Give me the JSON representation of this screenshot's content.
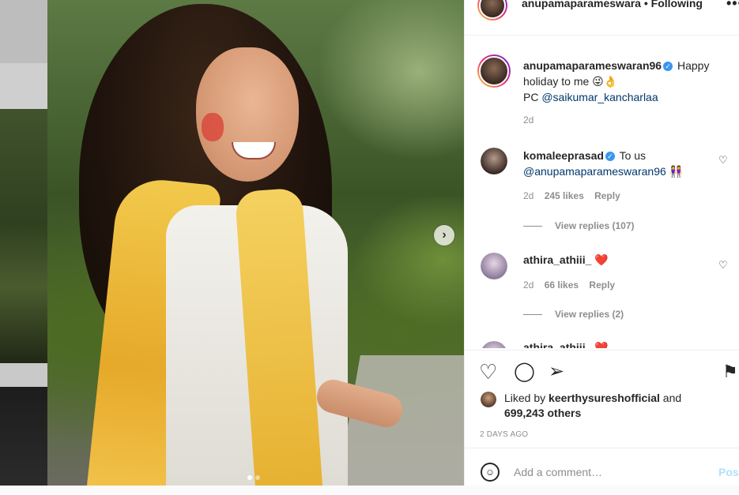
{
  "post": {
    "username": "anupamaparameswara",
    "dot": " •",
    "follow": "Following",
    "more": "•••",
    "verified_mark": "✓"
  },
  "caption": {
    "username": "anupamaparameswaran96",
    "text": "Happy holiday to me 😜👌",
    "pc_prefix": "PC ",
    "pc_link": "@saikumar_kancharlaa",
    "time": "2d"
  },
  "comments": [
    {
      "username": "komaleeprasad",
      "text": "To us",
      "mention": "@anupamaparameswaran96",
      "emoji": "👭",
      "time": "2d",
      "likes": "245 likes",
      "reply": "Reply",
      "view_replies": "View replies (107)"
    },
    {
      "username": "athira_athiii_",
      "emoji": "❤️",
      "time": "2d",
      "likes": "66 likes",
      "reply": "Reply",
      "view_replies": "View replies (2)"
    },
    {
      "username": "athira_athiii_",
      "emoji": "❤️"
    }
  ],
  "actions": {
    "liked_prefix": "Liked by ",
    "liked_user": "keerthysureshofficial",
    "liked_and": " and",
    "liked_others": "699,243 others",
    "date": "2 DAYS AGO"
  },
  "add_comment": {
    "placeholder": "Add a comment…",
    "post": "Post"
  },
  "icons": {
    "heart": "♡",
    "comment": "◯",
    "share": "➢",
    "save": "⚑",
    "next": "›",
    "smiley": "☺"
  },
  "colors": {
    "link": "#00376b",
    "muted": "#8e8e8e",
    "verified": "#3897f0",
    "heart_red": "#ed4956",
    "post_disabled": "#b2dffc"
  }
}
